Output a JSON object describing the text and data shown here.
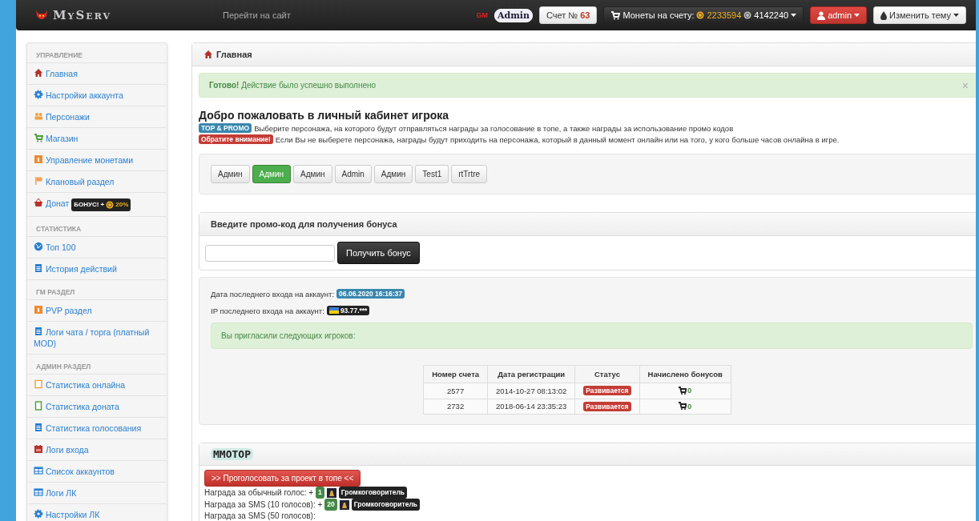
{
  "topbar": {
    "logo": "MyServ",
    "site_link": "Перейти на сайт",
    "gm_badge": "GM",
    "admin_badge": "Admin",
    "account": {
      "label": "Счет №",
      "number": "63"
    },
    "coins": {
      "label": "Монеты на счету:",
      "gold": "2233594",
      "silver": "4142240"
    },
    "user_menu": "admin",
    "theme_menu": "Изменить тему"
  },
  "sidebar": {
    "sections": [
      {
        "title": "УПРАВЛЕНИЕ",
        "items": [
          {
            "label": "Главная"
          },
          {
            "label": "Настройки аккаунта"
          },
          {
            "label": "Персонажи"
          },
          {
            "label": "Магазин"
          },
          {
            "label": "Управление монетами"
          },
          {
            "label": "Клановый раздел"
          },
          {
            "label": "Донат",
            "badge": "БОНУС! +",
            "badge_value": "20%"
          }
        ]
      },
      {
        "title": "СТАТИСТИКА",
        "items": [
          {
            "label": "Топ 100"
          },
          {
            "label": "История действий"
          }
        ]
      },
      {
        "title": "ГМ РАЗДЕЛ",
        "items": [
          {
            "label": "PVP раздел"
          },
          {
            "label": "Логи чата / торга (платный MOD)"
          }
        ]
      },
      {
        "title": "АДМИН РАЗДЕЛ",
        "items": [
          {
            "label": "Статистика онлайна"
          },
          {
            "label": "Статистика доната"
          },
          {
            "label": "Статистика голосования"
          },
          {
            "label": "Логи входа"
          },
          {
            "label": "Список аккаунтов"
          },
          {
            "label": "Логи ЛК"
          },
          {
            "label": "Настройки ЛК"
          }
        ]
      }
    ]
  },
  "main": {
    "title": "Главная",
    "alert": {
      "strong": "Готово!",
      "text": "Действие было успешно выполнено",
      "close": "×"
    },
    "welcome": {
      "heading": "Добро пожаловать в личный кабинет игрока",
      "lines": [
        {
          "tag": "TOP & PROMO",
          "color": "#3a87ad",
          "text": "Выберите персонажа, на которого будут отправляться награды за голосование в топе, а также награды за использование промо кодов"
        },
        {
          "tag": "Обратите внимание!",
          "color": "#c43c35",
          "text": "Если Вы не выберете персонажа, награды будут приходить на персонажа, который в данный момент онлайн или на того, у кого больше часов онлайна в игре."
        }
      ]
    },
    "characters": [
      {
        "name": "Админ",
        "selected": false
      },
      {
        "name": "Админ",
        "selected": true
      },
      {
        "name": "Админ",
        "selected": false
      },
      {
        "name": "Admin",
        "selected": false
      },
      {
        "name": "Админ",
        "selected": false
      },
      {
        "name": "Test1",
        "selected": false
      },
      {
        "name": "rtTrtre",
        "selected": false
      }
    ],
    "promo": {
      "title": "Введите промо-код для получения бонуса",
      "button": "Получить бонус"
    },
    "info": {
      "last_login_label": "Дата последнего входа на аккаунт:",
      "last_login": "06.06.2020 16:16:37",
      "ip_label": "IP последнего входа на аккаунт:",
      "ip": "93.77.***",
      "invited": "Вы пригласили следующих игроков:"
    },
    "table": {
      "columns": [
        "Номер счета",
        "Дата регистрации",
        "Статус",
        "Начислено бонусов"
      ],
      "rows": [
        {
          "account": "2577",
          "date": "2014-10-27 08:13:02",
          "status": "Развивается",
          "bonus": "0"
        },
        {
          "account": "2732",
          "date": "2018-06-14 23:35:23",
          "status": "Развивается",
          "bonus": "0"
        }
      ]
    },
    "vote": {
      "logo": "MMOTOP",
      "button": ">> Проголосовать за проект в топе <<",
      "rewards": [
        {
          "label": "Награда за обычный голос: +",
          "count": "1",
          "item": "Громкоговоритель"
        },
        {
          "label": "Награда за SMS (10 голосов): +",
          "count": "20",
          "item": "Громкоговоритель"
        },
        {
          "label": "Награда за SMS (50 голосов):"
        }
      ]
    }
  }
}
